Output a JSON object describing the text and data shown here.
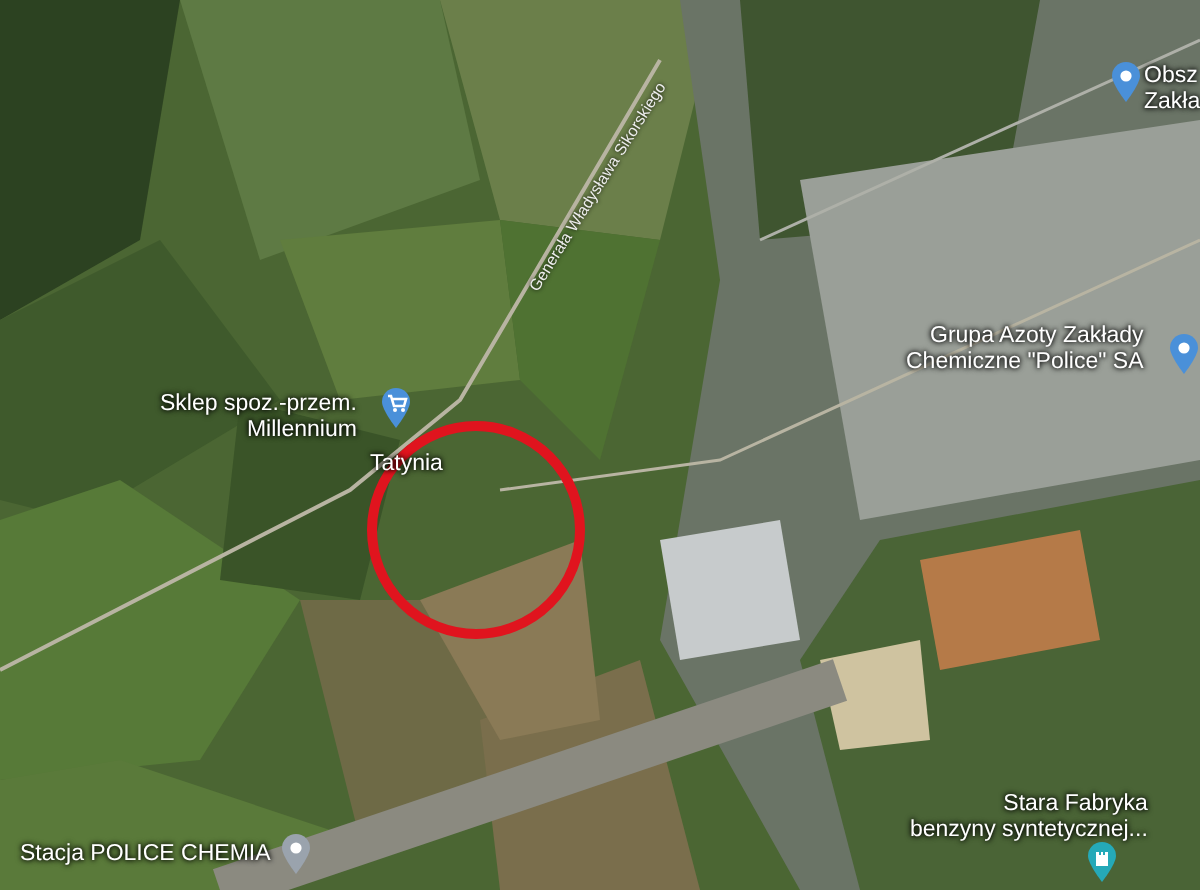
{
  "map": {
    "road_label": "Generała Władysława Sikorskiego",
    "places": [
      {
        "kind": "pin",
        "color": "#4a90d9",
        "lines": [
          "Obsz",
          "Zakła"
        ]
      },
      {
        "kind": "pin",
        "color": "#4a90d9",
        "lines": [
          "Grupa Azoty Zakłady",
          "Chemiczne \"Police\" SA"
        ]
      },
      {
        "kind": "shop",
        "color": "#4a90d9",
        "lines": [
          "Sklep spoz.-przem.",
          "Millennium"
        ]
      },
      {
        "kind": "town",
        "lines": [
          "Tatynia"
        ]
      },
      {
        "kind": "pin",
        "color": "#9aa3ad",
        "lines": [
          "Stacja POLICE CHEMIA"
        ]
      },
      {
        "kind": "landmark",
        "color": "#25a9b8",
        "lines": [
          "Stara Fabryka",
          "benzyny syntetycznej..."
        ]
      }
    ],
    "highlight": {
      "color": "#e0141e"
    }
  }
}
